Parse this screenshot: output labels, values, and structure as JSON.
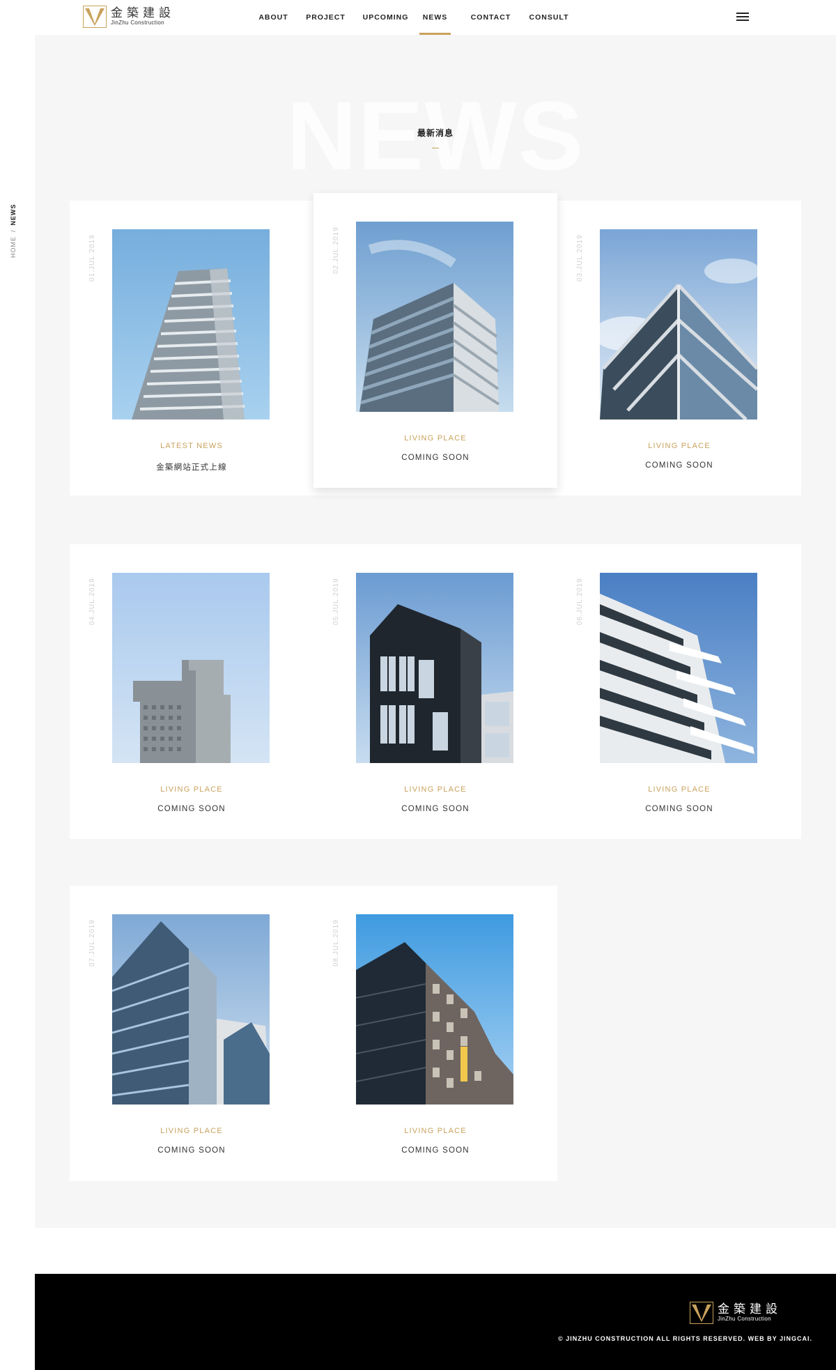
{
  "header": {
    "logo": {
      "cn": "金築建設",
      "en": "JinZhu Construction"
    },
    "nav": [
      {
        "label": "ABOUT"
      },
      {
        "label": "PROJECT"
      },
      {
        "label": "UPCOMING"
      },
      {
        "label": "NEWS",
        "active": true
      },
      {
        "label": "CONTACT"
      },
      {
        "label": "CONSULT"
      }
    ],
    "menu_icon": "hamburger-menu-icon"
  },
  "page": {
    "bg_title": "NEWS",
    "sub_title": "最新消息"
  },
  "breadcrumb": {
    "home": "HOME",
    "separator": "/",
    "current": "NEWS"
  },
  "cards": [
    {
      "date": "01.JUL.2019",
      "category": "LATEST NEWS",
      "title": "金築網站正式上線"
    },
    {
      "date": "02.JUL.2019",
      "category": "LIVING PLACE",
      "title": "COMING SOON"
    },
    {
      "date": "03.JUL.2019",
      "category": "LIVING PLACE",
      "title": "COMING SOON"
    },
    {
      "date": "04.JUL.2019",
      "category": "LIVING PLACE",
      "title": "COMING SOON"
    },
    {
      "date": "05.JUL.2019",
      "category": "LIVING PLACE",
      "title": "COMING SOON"
    },
    {
      "date": "06.JUL.2019",
      "category": "LIVING PLACE",
      "title": "COMING SOON"
    },
    {
      "date": "07.JUL.2019",
      "category": "LIVING PLACE",
      "title": "COMING SOON"
    },
    {
      "date": "08.JUL.2019",
      "category": "LIVING PLACE",
      "title": "COMING SOON"
    }
  ],
  "footer": {
    "logo": {
      "cn": "金築建設",
      "en": "JinZhu Construction"
    },
    "copyright": "© JINZHU CONSTRUCTION ALL RIGHTS RESERVED. WEB BY JINGCAI."
  },
  "colors": {
    "accent": "#c9a25c",
    "page_bg": "#f6f6f6",
    "footer_bg": "#000000"
  }
}
